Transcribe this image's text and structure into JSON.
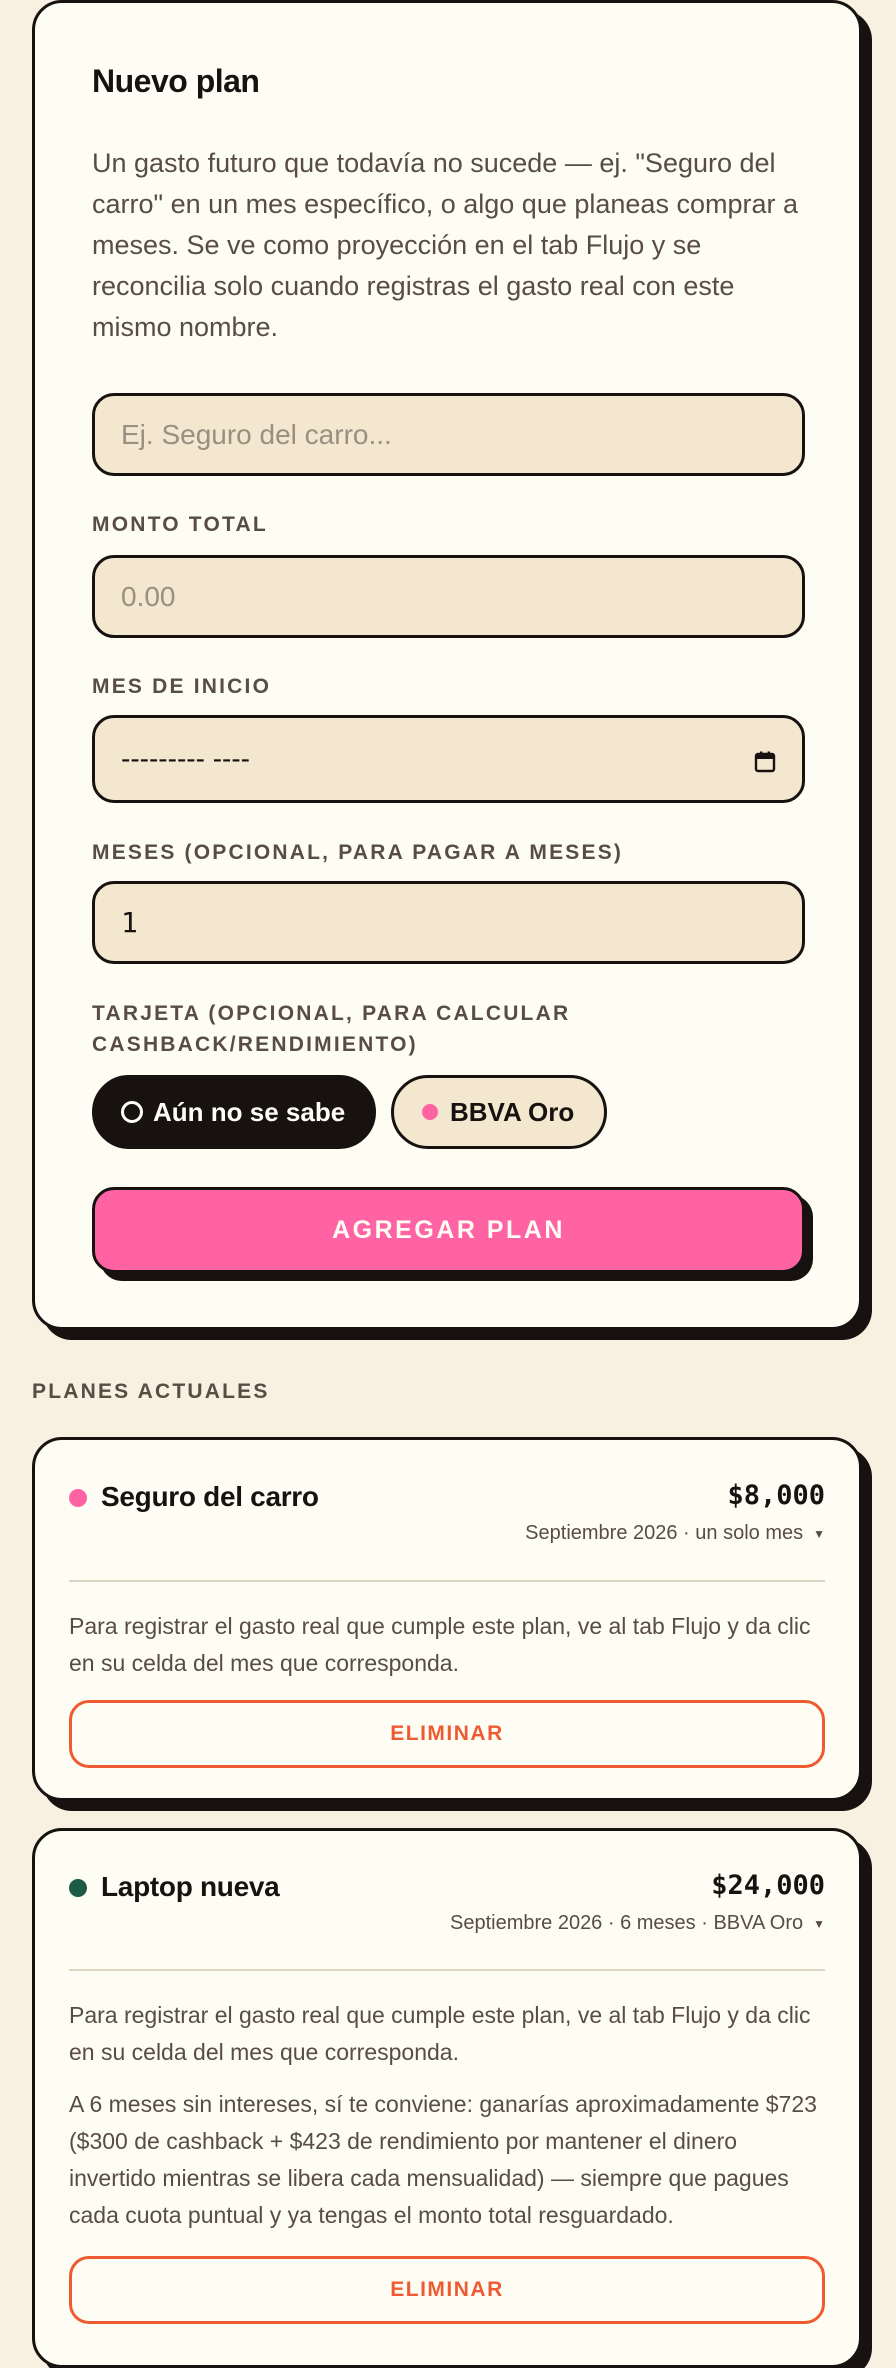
{
  "form": {
    "title": "Nuevo plan",
    "description": "Un gasto futuro que todavía no sucede — ej. \"Seguro del carro\" en un mes específico, o algo que planeas comprar a meses. Se ve como proyección en el tab Flujo y se reconcilia solo cuando registras el gasto real con este mismo nombre.",
    "name_placeholder": "Ej. Seguro del carro...",
    "amount_label": "MONTO TOTAL",
    "amount_placeholder": "0.00",
    "start_label": "MES DE INICIO",
    "start_value": "--------- ----",
    "months_label": "MESES (OPCIONAL, PARA PAGAR A MESES)",
    "months_value": "1",
    "card_label": "TARJETA (OPCIONAL, PARA CALCULAR CASHBACK/RENDIMIENTO)",
    "card_options": [
      {
        "label": "Aún no se sabe",
        "selected": true
      },
      {
        "label": "BBVA Oro",
        "selected": false,
        "color": "#ff63a3"
      }
    ],
    "submit_label": "AGREGAR PLAN"
  },
  "plans_section": {
    "title": "PLANES ACTUALES",
    "plans": [
      {
        "name": "Seguro del carro",
        "amount": "$8,000",
        "meta": "Septiembre 2026 · un solo mes",
        "dot_color": "#ff63a3",
        "note": "Para registrar el gasto real que cumple este plan, ve al tab Flujo y da clic en su celda del mes que corresponda.",
        "advice": "",
        "delete_label": "ELIMINAR"
      },
      {
        "name": "Laptop nueva",
        "amount": "$24,000",
        "meta": "Septiembre 2026 · 6 meses · BBVA Oro",
        "dot_color": "#1d5a47",
        "note": "Para registrar el gasto real que cumple este plan, ve al tab Flujo y da clic en su celda del mes que corresponda.",
        "advice": "A 6 meses sin intereses, sí te conviene: ganarías aproximadamente $723 ($300 de cashback + $423 de rendimiento por mantener el dinero invertido mientras se libera cada mensualidad) — siempre que pagues cada cuota puntual y ya tengas el monto total resguardado.",
        "delete_label": "ELIMINAR"
      }
    ]
  },
  "colors": {
    "background": "#f8f1e2",
    "card": "#fefdf4",
    "input": "#f3e7d0",
    "ink": "#17120f",
    "accent": "#ff63a3",
    "danger": "#ee5b33"
  }
}
